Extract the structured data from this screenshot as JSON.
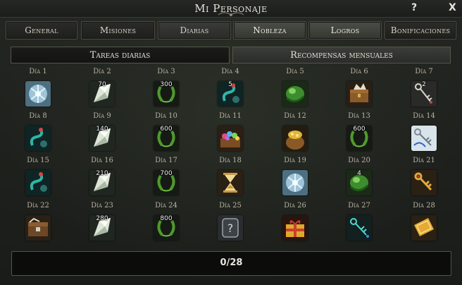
{
  "window": {
    "title": "Mi Personaje",
    "help": "?",
    "close": "X"
  },
  "tabs": [
    {
      "label": "General"
    },
    {
      "label": "Misiones"
    },
    {
      "label": "Diarias"
    },
    {
      "label": "Nobleza"
    },
    {
      "label": "Logros"
    },
    {
      "label": "Bonificaciones"
    }
  ],
  "subtabs": [
    {
      "label": "Tareas diarias"
    },
    {
      "label": "Recompensas mensuales"
    }
  ],
  "days": [
    {
      "label": "Día 1",
      "icon": "blue-crystal-orb-icon",
      "qty": ""
    },
    {
      "label": "Día 2",
      "icon": "crystal-shard-icon",
      "qty": "70"
    },
    {
      "label": "Día 3",
      "icon": "laurel-wreath-icon",
      "qty": "300"
    },
    {
      "label": "Día 4",
      "icon": "teal-serpent-potion-icon",
      "qty": "5"
    },
    {
      "label": "Día 5",
      "icon": "green-orb-icon",
      "qty": ""
    },
    {
      "label": "Día 6",
      "icon": "treasure-chest-icon",
      "qty": ""
    },
    {
      "label": "Día 7",
      "icon": "silver-key-icon",
      "qty": "2"
    },
    {
      "label": "Día 8",
      "icon": "teal-serpent-potion-icon",
      "qty": ""
    },
    {
      "label": "Día 9",
      "icon": "crystal-shard-icon",
      "qty": "140"
    },
    {
      "label": "Día 10",
      "icon": "laurel-wreath-icon",
      "qty": "600"
    },
    {
      "label": "Día 11",
      "icon": "gem-chest-icon",
      "qty": ""
    },
    {
      "label": "Día 12",
      "icon": "gold-sack-icon",
      "qty": ""
    },
    {
      "label": "Día 13",
      "icon": "laurel-wreath-icon",
      "qty": "600"
    },
    {
      "label": "Día 14",
      "icon": "blue-key-icon",
      "qty": ""
    },
    {
      "label": "Día 15",
      "icon": "teal-serpent-potion-icon",
      "qty": ""
    },
    {
      "label": "Día 16",
      "icon": "crystal-shard-icon",
      "qty": "210"
    },
    {
      "label": "Día 17",
      "icon": "laurel-wreath-icon",
      "qty": "700"
    },
    {
      "label": "Día 18",
      "icon": "hourglass-icon",
      "qty": ""
    },
    {
      "label": "Día 19",
      "icon": "blue-crystal-orb-icon",
      "qty": ""
    },
    {
      "label": "Día 20",
      "icon": "green-orb-icon",
      "qty": "4"
    },
    {
      "label": "Día 21",
      "icon": "gold-key-icon",
      "qty": ""
    },
    {
      "label": "Día 22",
      "icon": "wooden-chest-icon",
      "qty": ""
    },
    {
      "label": "Día 23",
      "icon": "crystal-shard-icon",
      "qty": "280"
    },
    {
      "label": "Día 24",
      "icon": "laurel-wreath-icon",
      "qty": "800"
    },
    {
      "label": "Día 25",
      "icon": "mystery-icon",
      "qty": ""
    },
    {
      "label": "Día 26",
      "icon": "gift-box-icon",
      "qty": ""
    },
    {
      "label": "Día 27",
      "icon": "cyan-key-icon",
      "qty": ""
    },
    {
      "label": "Día 28",
      "icon": "gold-ticket-icon",
      "qty": ""
    }
  ],
  "progress": {
    "text": "0/28",
    "fraction": 0
  }
}
